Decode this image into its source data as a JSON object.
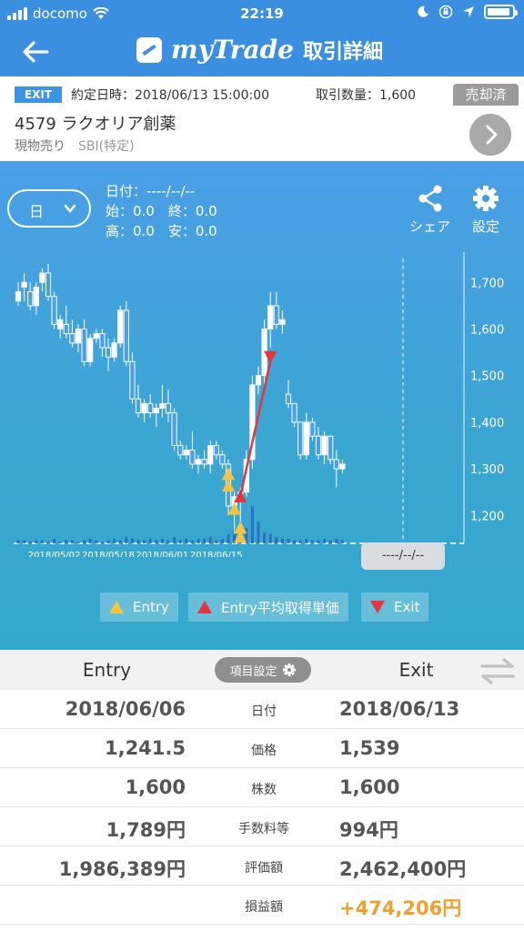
{
  "status": {
    "carrier": "docomo",
    "time": "22:19"
  },
  "nav": {
    "brand": "myTrade",
    "title": "取引詳細"
  },
  "info": {
    "exit_badge": "EXIT",
    "contract_datetime": "約定日時：2018/06/13 15:00:00",
    "quantity": "取引数量：1,600",
    "status_badge": "売却済",
    "stock": "4579 ラクオリア創薬",
    "trade_type": "現物売り",
    "account": "SBI(特定)"
  },
  "chart_panel": {
    "period": "日",
    "date_line": "日付：----/--/--",
    "open_close": "始：0.0　終：0.0",
    "high_low": "高：0.0　安：0.0",
    "share_label": "シェア",
    "settings_label": "設定",
    "cursor_date": "----/--/--",
    "legend": {
      "entry": "Entry",
      "entry_avg": "Entry平均取得単価",
      "exit": "Exit"
    },
    "colors": {
      "entry_marker": "#f5c542",
      "avg_marker": "#e5343b",
      "exit_marker": "#e5343b"
    }
  },
  "chart_data": {
    "type": "candlestick",
    "y_ticks": [
      "1,700",
      "1,600",
      "1,500",
      "1,400",
      "1,300",
      "1,200"
    ],
    "y_tick_values": [
      1700,
      1600,
      1500,
      1400,
      1300,
      1200
    ],
    "x_ticks": [
      "2018/05/02",
      "2018/05/18",
      "2018/06/01",
      "2018/06/15"
    ],
    "x_tick_index": [
      6,
      15,
      24,
      33
    ],
    "ylim": [
      1140,
      1765
    ],
    "candles": [
      [
        1660,
        1700,
        1650,
        1680
      ],
      [
        1690,
        1720,
        1660,
        1700
      ],
      [
        1680,
        1700,
        1640,
        1650
      ],
      [
        1650,
        1700,
        1630,
        1690
      ],
      [
        1700,
        1730,
        1680,
        1720
      ],
      [
        1720,
        1740,
        1660,
        1670
      ],
      [
        1670,
        1680,
        1600,
        1610
      ],
      [
        1600,
        1630,
        1580,
        1620
      ],
      [
        1610,
        1650,
        1580,
        1590
      ],
      [
        1590,
        1620,
        1560,
        1570
      ],
      [
        1570,
        1610,
        1550,
        1600
      ],
      [
        1600,
        1620,
        1520,
        1530
      ],
      [
        1530,
        1590,
        1520,
        1580
      ],
      [
        1580,
        1600,
        1570,
        1590
      ],
      [
        1590,
        1600,
        1540,
        1560
      ],
      [
        1560,
        1580,
        1510,
        1540
      ],
      [
        1540,
        1580,
        1530,
        1570
      ],
      [
        1570,
        1650,
        1560,
        1640
      ],
      [
        1640,
        1660,
        1520,
        1530
      ],
      [
        1530,
        1550,
        1440,
        1450
      ],
      [
        1450,
        1480,
        1410,
        1420
      ],
      [
        1420,
        1450,
        1400,
        1440
      ],
      [
        1440,
        1460,
        1410,
        1420
      ],
      [
        1420,
        1440,
        1390,
        1430
      ],
      [
        1430,
        1480,
        1410,
        1440
      ],
      [
        1440,
        1470,
        1400,
        1420
      ],
      [
        1420,
        1430,
        1340,
        1350
      ],
      [
        1350,
        1360,
        1320,
        1330
      ],
      [
        1330,
        1350,
        1320,
        1340
      ],
      [
        1340,
        1380,
        1300,
        1310
      ],
      [
        1310,
        1330,
        1290,
        1320
      ],
      [
        1320,
        1340,
        1300,
        1310
      ],
      [
        1310,
        1360,
        1290,
        1350
      ],
      [
        1350,
        1360,
        1320,
        1330
      ],
      [
        1330,
        1340,
        1300,
        1310
      ],
      [
        1310,
        1320,
        1200,
        1220
      ],
      [
        1220,
        1250,
        1160,
        1240
      ],
      [
        1240,
        1260,
        1180,
        1250
      ],
      [
        1250,
        1340,
        1240,
        1320
      ],
      [
        1320,
        1500,
        1300,
        1480
      ],
      [
        1480,
        1520,
        1460,
        1500
      ],
      [
        1500,
        1620,
        1480,
        1600
      ],
      [
        1600,
        1680,
        1560,
        1650
      ],
      [
        1650,
        1680,
        1600,
        1610
      ],
      [
        1610,
        1640,
        1590,
        1620
      ],
      [
        1460,
        1490,
        1430,
        1440
      ],
      [
        1440,
        1440,
        1390,
        1400
      ],
      [
        1400,
        1400,
        1320,
        1330
      ],
      [
        1330,
        1420,
        1320,
        1400
      ],
      [
        1400,
        1410,
        1360,
        1370
      ],
      [
        1370,
        1390,
        1320,
        1330
      ],
      [
        1330,
        1380,
        1310,
        1370
      ],
      [
        1370,
        1370,
        1310,
        1320
      ],
      [
        1320,
        1340,
        1260,
        1300
      ],
      [
        1300,
        1320,
        1290,
        1310
      ]
    ],
    "volume_rel": [
      2,
      2,
      1,
      2,
      2,
      1,
      3,
      1,
      2,
      2,
      1,
      2,
      3,
      2,
      1,
      2,
      3,
      2,
      4,
      3,
      2,
      2,
      3,
      2,
      3,
      2,
      4,
      2,
      3,
      2,
      3,
      3,
      4,
      2,
      3,
      6,
      9,
      8,
      10,
      24,
      14,
      7,
      6,
      4,
      3,
      3,
      2,
      2,
      3,
      2,
      2,
      3,
      2,
      3,
      2
    ],
    "markers": [
      {
        "kind": "entry",
        "index": 35,
        "price": 1290
      },
      {
        "kind": "entry",
        "index": 35,
        "price": 1265
      },
      {
        "kind": "entry",
        "index": 36,
        "price": 1215
      },
      {
        "kind": "entry",
        "index": 37,
        "price": 1175
      },
      {
        "kind": "entry",
        "index": 37,
        "price": 1155
      },
      {
        "kind": "entry_avg",
        "index": 37,
        "price": 1241.5
      },
      {
        "kind": "exit",
        "index": 42,
        "price": 1539
      }
    ]
  },
  "table": {
    "head_entry": "Entry",
    "head_exit": "Exit",
    "item_settings": "項目設定",
    "rows": [
      {
        "entry": "2018/06/06",
        "label": "日付",
        "exit": "2018/06/13"
      },
      {
        "entry": "1,241.5",
        "label": "価格",
        "exit": "1,539"
      },
      {
        "entry": "1,600",
        "label": "株数",
        "exit": "1,600"
      },
      {
        "entry": "1,789円",
        "label": "手数料等",
        "exit": "994円"
      },
      {
        "entry": "1,986,389円",
        "label": "評価額",
        "exit": "2,462,400円"
      },
      {
        "entry": "",
        "label": "損益額",
        "exit": "+474,206円"
      }
    ]
  }
}
